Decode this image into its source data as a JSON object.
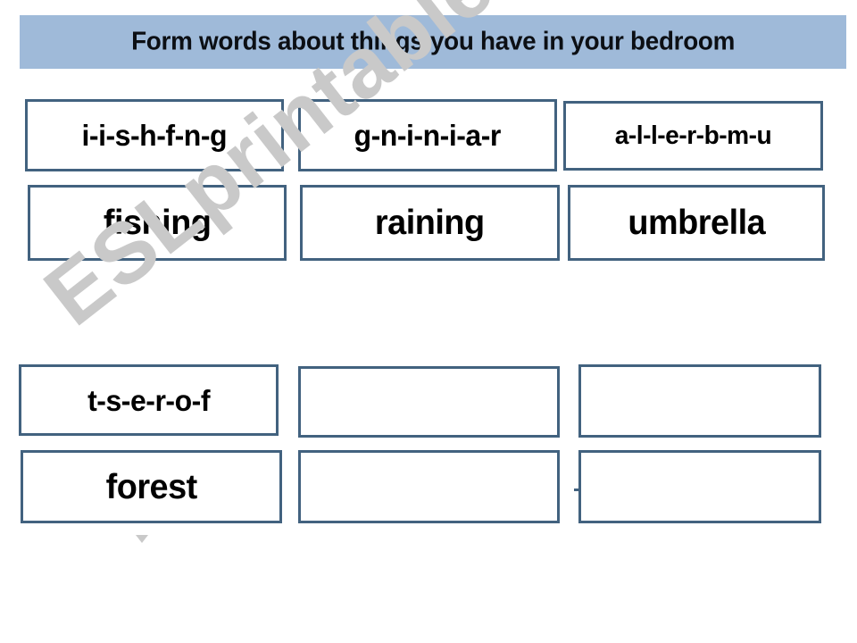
{
  "banner": {
    "title": "Form words about things you have in your bedroom",
    "background_color": "#9FBAD9",
    "text_color": "#0C0F14"
  },
  "watermark": {
    "text": "ESLprintables.com",
    "color": "#C9C9C9"
  },
  "style": {
    "box_border_color": "#42627F",
    "canvas_background": "#FFFFFF"
  },
  "groups": [
    {
      "name": "top-group",
      "columns": [
        {
          "scramble": "i-i-s-h-f-n-g",
          "answer": "fishing"
        },
        {
          "scramble": "g-n-i-n-i-a-r",
          "answer": "raining"
        },
        {
          "scramble": "a-l-l-e-r-b-m-u",
          "answer": "umbrella"
        }
      ]
    },
    {
      "name": "bottom-group",
      "columns": [
        {
          "scramble": "t-s-e-r-o-f",
          "answer": "forest"
        },
        {
          "scramble": "",
          "answer": ""
        },
        {
          "scramble": "",
          "answer": ""
        }
      ]
    }
  ]
}
